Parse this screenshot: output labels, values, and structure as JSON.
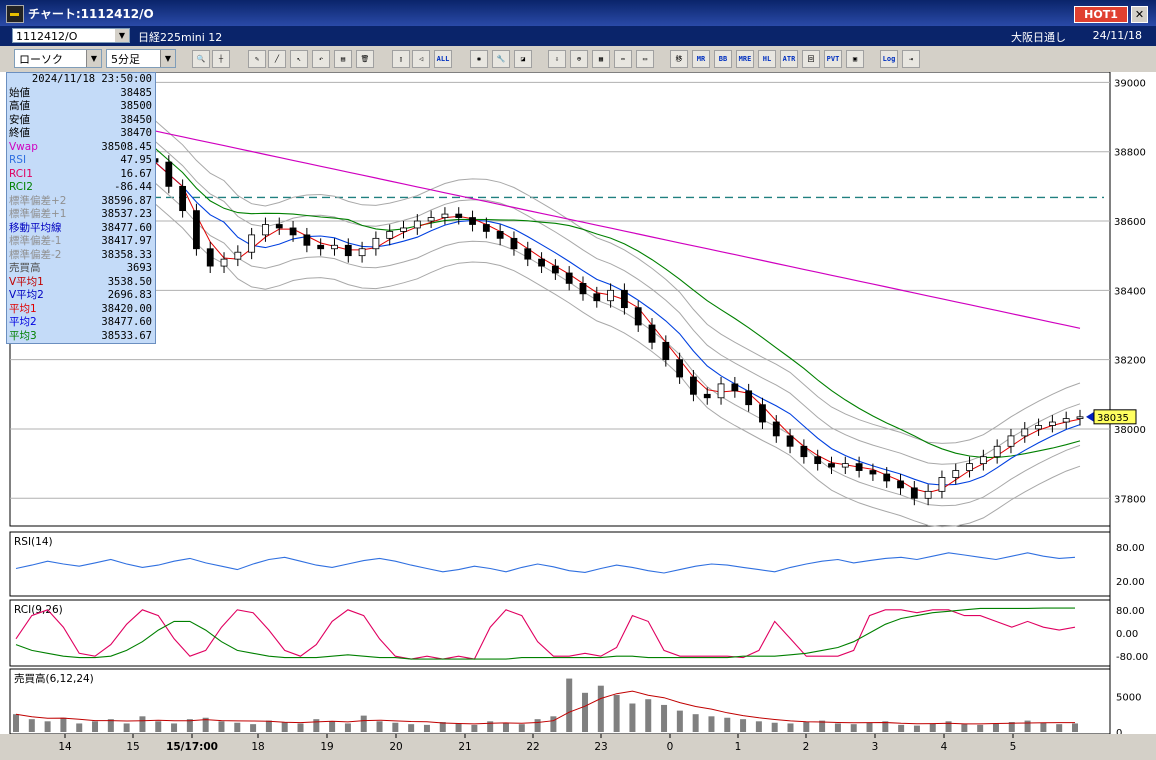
{
  "window": {
    "title": "チャート:1112412/O",
    "hot_badge": "HOT1",
    "close_label": "✕"
  },
  "header": {
    "symbol": "1112412/O",
    "product": "日経225mini 12",
    "exchange": "大阪日通し",
    "date": "24/11/18"
  },
  "toolbar": {
    "chart_type": "ローソク",
    "interval": "5分足",
    "tools": [
      {
        "name": "zoom-icon",
        "label": "🔍"
      },
      {
        "name": "crosshair-icon",
        "label": "┼"
      },
      {
        "name": "pencil-icon",
        "label": "✎"
      },
      {
        "name": "line-icon",
        "label": "╱"
      },
      {
        "name": "pointer-icon",
        "label": "↖"
      },
      {
        "name": "undo-icon",
        "label": "↶"
      },
      {
        "name": "note-icon",
        "label": "▤"
      },
      {
        "name": "trash-icon",
        "label": "🗑"
      },
      {
        "name": "candle-icon",
        "label": "▯"
      },
      {
        "name": "speaker-icon",
        "label": "◁"
      },
      {
        "name": "all-icon",
        "label": "ALL"
      },
      {
        "name": "gear-icon",
        "label": "✱"
      },
      {
        "name": "wrench-icon",
        "label": "🔧"
      },
      {
        "name": "palette-icon",
        "label": "◪"
      },
      {
        "name": "download-icon",
        "label": "⇩"
      },
      {
        "name": "search-chart-icon",
        "label": "⊕"
      },
      {
        "name": "grid-icon",
        "label": "▦"
      },
      {
        "name": "arrows-icon",
        "label": "⇔"
      },
      {
        "name": "note-gray-icon",
        "label": "▭"
      },
      {
        "name": "indicator-ma",
        "label": "移"
      },
      {
        "name": "indicator-mr",
        "label": "MR"
      },
      {
        "name": "indicator-bb",
        "label": "BB"
      },
      {
        "name": "indicator-mre",
        "label": "MRE"
      },
      {
        "name": "indicator-hl",
        "label": "HL"
      },
      {
        "name": "indicator-atr",
        "label": "ATR"
      },
      {
        "name": "indicator-pv",
        "label": "回"
      },
      {
        "name": "indicator-pvt",
        "label": "PVT"
      },
      {
        "name": "frame-icon",
        "label": "▣"
      },
      {
        "name": "log-button",
        "label": "Log"
      },
      {
        "name": "export-icon",
        "label": "⇥"
      }
    ]
  },
  "info_panel": {
    "timestamp": "2024/11/18  23:50:00",
    "rows": [
      {
        "label": "始値",
        "value": "38485",
        "color": "#000000"
      },
      {
        "label": "高値",
        "value": "38500",
        "color": "#000000"
      },
      {
        "label": "安値",
        "value": "38450",
        "color": "#000000"
      },
      {
        "label": "終値",
        "value": "38470",
        "color": "#000000"
      },
      {
        "label": "Vwap",
        "value": "38508.45",
        "color": "#d000c0"
      },
      {
        "label": "RSI",
        "value": "47.95",
        "color": "#3070e0"
      },
      {
        "label": "RCI1",
        "value": "16.67",
        "color": "#e00060"
      },
      {
        "label": "RCI2",
        "value": "-86.44",
        "color": "#008000"
      },
      {
        "label": "標準偏差+2",
        "value": "38596.87",
        "color": "#909090"
      },
      {
        "label": "標準偏差+1",
        "value": "38537.23",
        "color": "#909090"
      },
      {
        "label": "移動平均線",
        "value": "38477.60",
        "color": "#0000c0"
      },
      {
        "label": "標準偏差-1",
        "value": "38417.97",
        "color": "#909090"
      },
      {
        "label": "標準偏差-2",
        "value": "38358.33",
        "color": "#909090"
      },
      {
        "label": "売買高",
        "value": "3693",
        "color": "#505050"
      },
      {
        "label": "V平均1",
        "value": "3538.50",
        "color": "#c00000"
      },
      {
        "label": "V平均2",
        "value": "2696.83",
        "color": "#0000c0"
      },
      {
        "label": "平均1",
        "value": "38420.00",
        "color": "#e00000"
      },
      {
        "label": "平均2",
        "value": "38477.60",
        "color": "#0000e0"
      },
      {
        "label": "平均3",
        "value": "38533.67",
        "color": "#008000"
      }
    ]
  },
  "chart_data": [
    {
      "type": "candlestick",
      "panel": "price",
      "ylim": [
        37720,
        39030
      ],
      "y_ticks": [
        "39000",
        "38800",
        "38600",
        "38400",
        "38200",
        "38000",
        "37800"
      ],
      "last_price": "38035",
      "dashed_level": 38668,
      "x_ticks": [
        "14",
        "15",
        "15/17:00",
        "18",
        "19",
        "20",
        "21",
        "22",
        "23",
        "0",
        "1",
        "2",
        "3",
        "4",
        "5"
      ],
      "candles_close_path": [
        38770,
        38700,
        38630,
        38520,
        38470,
        38490,
        38510,
        38560,
        38590,
        38580,
        38560,
        38530,
        38520,
        38530,
        38500,
        38520,
        38550,
        38570,
        38580,
        38600,
        38610,
        38620,
        38610,
        38590,
        38570,
        38550,
        38520,
        38490,
        38470,
        38450,
        38420,
        38390,
        38370,
        38400,
        38350,
        38300,
        38250,
        38200,
        38150,
        38100,
        38090,
        38130,
        38110,
        38070,
        38020,
        37980,
        37950,
        37920,
        37900,
        37890,
        37900,
        37880,
        37870,
        37850,
        37830,
        37800,
        37820,
        37860,
        37880,
        37900,
        37920,
        37950,
        37980,
        38000,
        38010,
        38020,
        38030,
        38035
      ],
      "series": [
        {
          "name": "平均1",
          "color": "#e00000"
        },
        {
          "name": "平均2",
          "color": "#0000e0"
        },
        {
          "name": "平均3",
          "color": "#008000"
        },
        {
          "name": "Vwap",
          "color": "#d000c0"
        }
      ]
    },
    {
      "type": "line",
      "panel": "rsi",
      "title": "RSI(14)",
      "y_ticks": [
        "80.00",
        "20.00"
      ],
      "ylim": [
        0,
        100
      ],
      "series": [
        {
          "name": "RSI",
          "color": "#3070e0",
          "values": [
            42,
            48,
            55,
            50,
            46,
            52,
            58,
            50,
            44,
            48,
            55,
            60,
            52,
            46,
            40,
            50,
            58,
            62,
            55,
            48,
            44,
            50,
            56,
            60,
            55,
            48,
            42,
            36,
            40,
            46,
            42,
            36,
            44,
            50,
            45,
            38,
            35,
            42,
            48,
            44,
            38,
            34,
            40,
            46,
            50,
            48,
            44,
            40,
            36,
            44,
            50,
            55,
            58,
            52,
            56,
            60,
            62,
            58,
            64,
            70,
            66,
            62,
            58,
            64,
            70,
            64,
            60,
            62
          ]
        }
      ]
    },
    {
      "type": "line",
      "panel": "rci",
      "title": "RCI(9,26)",
      "y_ticks": [
        "80.00",
        "0.00",
        "-80.00"
      ],
      "ylim": [
        -100,
        100
      ],
      "series": [
        {
          "name": "RCI1",
          "color": "#e00060",
          "values": [
            -20,
            60,
            80,
            20,
            -70,
            -80,
            -40,
            30,
            80,
            60,
            -20,
            -80,
            -60,
            20,
            80,
            70,
            10,
            -60,
            -80,
            -40,
            40,
            80,
            60,
            -20,
            -80,
            -90,
            -80,
            -90,
            -80,
            -90,
            20,
            80,
            60,
            -30,
            -80,
            -80,
            -70,
            -80,
            -50,
            60,
            40,
            -60,
            -80,
            -80,
            -80,
            -80,
            -85,
            -60,
            40,
            -20,
            -80,
            -80,
            -80,
            -60,
            60,
            80,
            80,
            70,
            80,
            80,
            60,
            60,
            40,
            20,
            40,
            20,
            10,
            20
          ]
        },
        {
          "name": "RCI2",
          "color": "#008000",
          "values": [
            -40,
            -60,
            -70,
            -80,
            -85,
            -85,
            -80,
            -60,
            -30,
            10,
            40,
            40,
            10,
            -30,
            -60,
            -70,
            -80,
            -85,
            -85,
            -85,
            -80,
            -75,
            -80,
            -85,
            -85,
            -90,
            -90,
            -90,
            -90,
            -90,
            -90,
            -90,
            -85,
            -85,
            -85,
            -85,
            -85,
            -85,
            -80,
            -80,
            -85,
            -85,
            -85,
            -85,
            -85,
            -85,
            -80,
            -80,
            -80,
            -75,
            -70,
            -60,
            -50,
            -30,
            0,
            30,
            50,
            60,
            70,
            75,
            80,
            85,
            85,
            85,
            85,
            86,
            86,
            86
          ]
        }
      ]
    },
    {
      "type": "bar",
      "panel": "volume",
      "title": "売買高(6,12,24)",
      "y_ticks": [
        "5000",
        "0"
      ],
      "ylim": [
        0,
        8000
      ],
      "values": [
        2500,
        1800,
        1500,
        2000,
        1200,
        1500,
        1800,
        1200,
        2200,
        1500,
        1200,
        1800,
        2000,
        1500,
        1300,
        1100,
        1600,
        1400,
        1200,
        1800,
        1500,
        1200,
        2300,
        1500,
        1300,
        1100,
        1000,
        1400,
        1200,
        1000,
        1500,
        1300,
        1100,
        1800,
        2200,
        7500,
        5500,
        6500,
        5200,
        4000,
        4600,
        3800,
        3000,
        2500,
        2200,
        2000,
        1800,
        1500,
        1300,
        1200,
        1400,
        1600,
        1200,
        1100,
        1300,
        1500,
        1000,
        900,
        1200,
        1500,
        1100,
        1000,
        1200,
        1400,
        1600,
        1300,
        1100,
        1200
      ]
    }
  ]
}
